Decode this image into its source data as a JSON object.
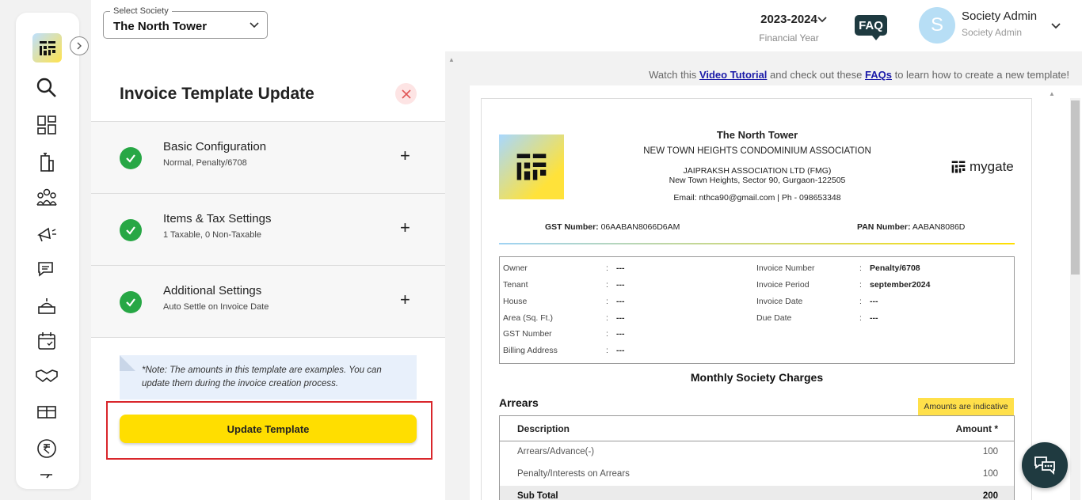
{
  "topbar": {
    "society_label": "Select Society",
    "society_value": "The North Tower",
    "financial_year": "2023-2024",
    "financial_year_label": "Financial Year",
    "faq": "FAQ",
    "avatar_initial": "S",
    "user_name": "Society Admin",
    "user_role": "Society Admin"
  },
  "sidebar": {
    "icons": [
      "search-icon",
      "dashboard-icon",
      "building-icon",
      "residents-icon",
      "announcement-icon",
      "chat-icon",
      "service-icon",
      "calendar-icon",
      "handshake-icon",
      "inventory-icon",
      "rupee-icon",
      "checklist-icon"
    ]
  },
  "panel": {
    "title": "Invoice Template Update",
    "steps": [
      {
        "title": "Basic Configuration",
        "subtitle": "Normal, Penalty/6708"
      },
      {
        "title": "Items & Tax Settings",
        "subtitle": "1 Taxable, 0 Non-Taxable"
      },
      {
        "title": "Additional Settings",
        "subtitle": "Auto Settle on Invoice Date"
      }
    ],
    "note": "*Note: The amounts in this template are examples. You can update them during the invoice creation process.",
    "update_button": "Update Template"
  },
  "preview": {
    "hint_prefix": "Watch this ",
    "hint_link1": "Video Tutorial",
    "hint_middle": " and check out these ",
    "hint_link2": "FAQs",
    "hint_suffix": " to learn how to create a new template!"
  },
  "invoice": {
    "society": "The North Tower",
    "association": "NEW TOWN HEIGHTS CONDOMINIUM ASSOCIATION",
    "company": "JAIPRAKSH ASSOCIATION LTD (FMG)",
    "address": "New Town Heights, Sector 90, Gurgaon-122505",
    "contact": "Email: nthca90@gmail.com | Ph - 098653348",
    "brand": "mygate",
    "gst_label": "GST Number:",
    "gst_value": "06AABAN8066D6AM",
    "pan_label": "PAN Number:",
    "pan_value": "AABAN8086D",
    "left_fields": [
      {
        "key": "Owner",
        "value": "---"
      },
      {
        "key": "Tenant",
        "value": "---"
      },
      {
        "key": "House",
        "value": "---"
      },
      {
        "key": "Area (Sq. Ft.)",
        "value": "---"
      },
      {
        "key": "GST Number",
        "value": "---"
      },
      {
        "key": "Billing Address",
        "value": "---"
      }
    ],
    "right_fields": [
      {
        "key": "Invoice Number",
        "value": "Penalty/6708"
      },
      {
        "key": "Invoice Period",
        "value": "september2024"
      },
      {
        "key": "Invoice Date",
        "value": "---"
      },
      {
        "key": "Due Date",
        "value": "---"
      }
    ],
    "charges_title": "Monthly Society Charges",
    "arrears_title": "Arrears",
    "indicative": "Amounts are indicative",
    "table_header": {
      "description": "Description",
      "amount": "Amount *"
    },
    "rows": [
      {
        "description": "Arrears/Advance(-)",
        "amount": "100"
      },
      {
        "description": "Penalty/Interests on Arrears",
        "amount": "100"
      }
    ],
    "subtotal": {
      "description": "Sub Total",
      "amount": "200"
    }
  },
  "colors": {
    "accent_yellow": "#ffde00",
    "dark_teal": "#1e3a40",
    "success_green": "#27a745",
    "highlight_red": "#d9262b"
  }
}
